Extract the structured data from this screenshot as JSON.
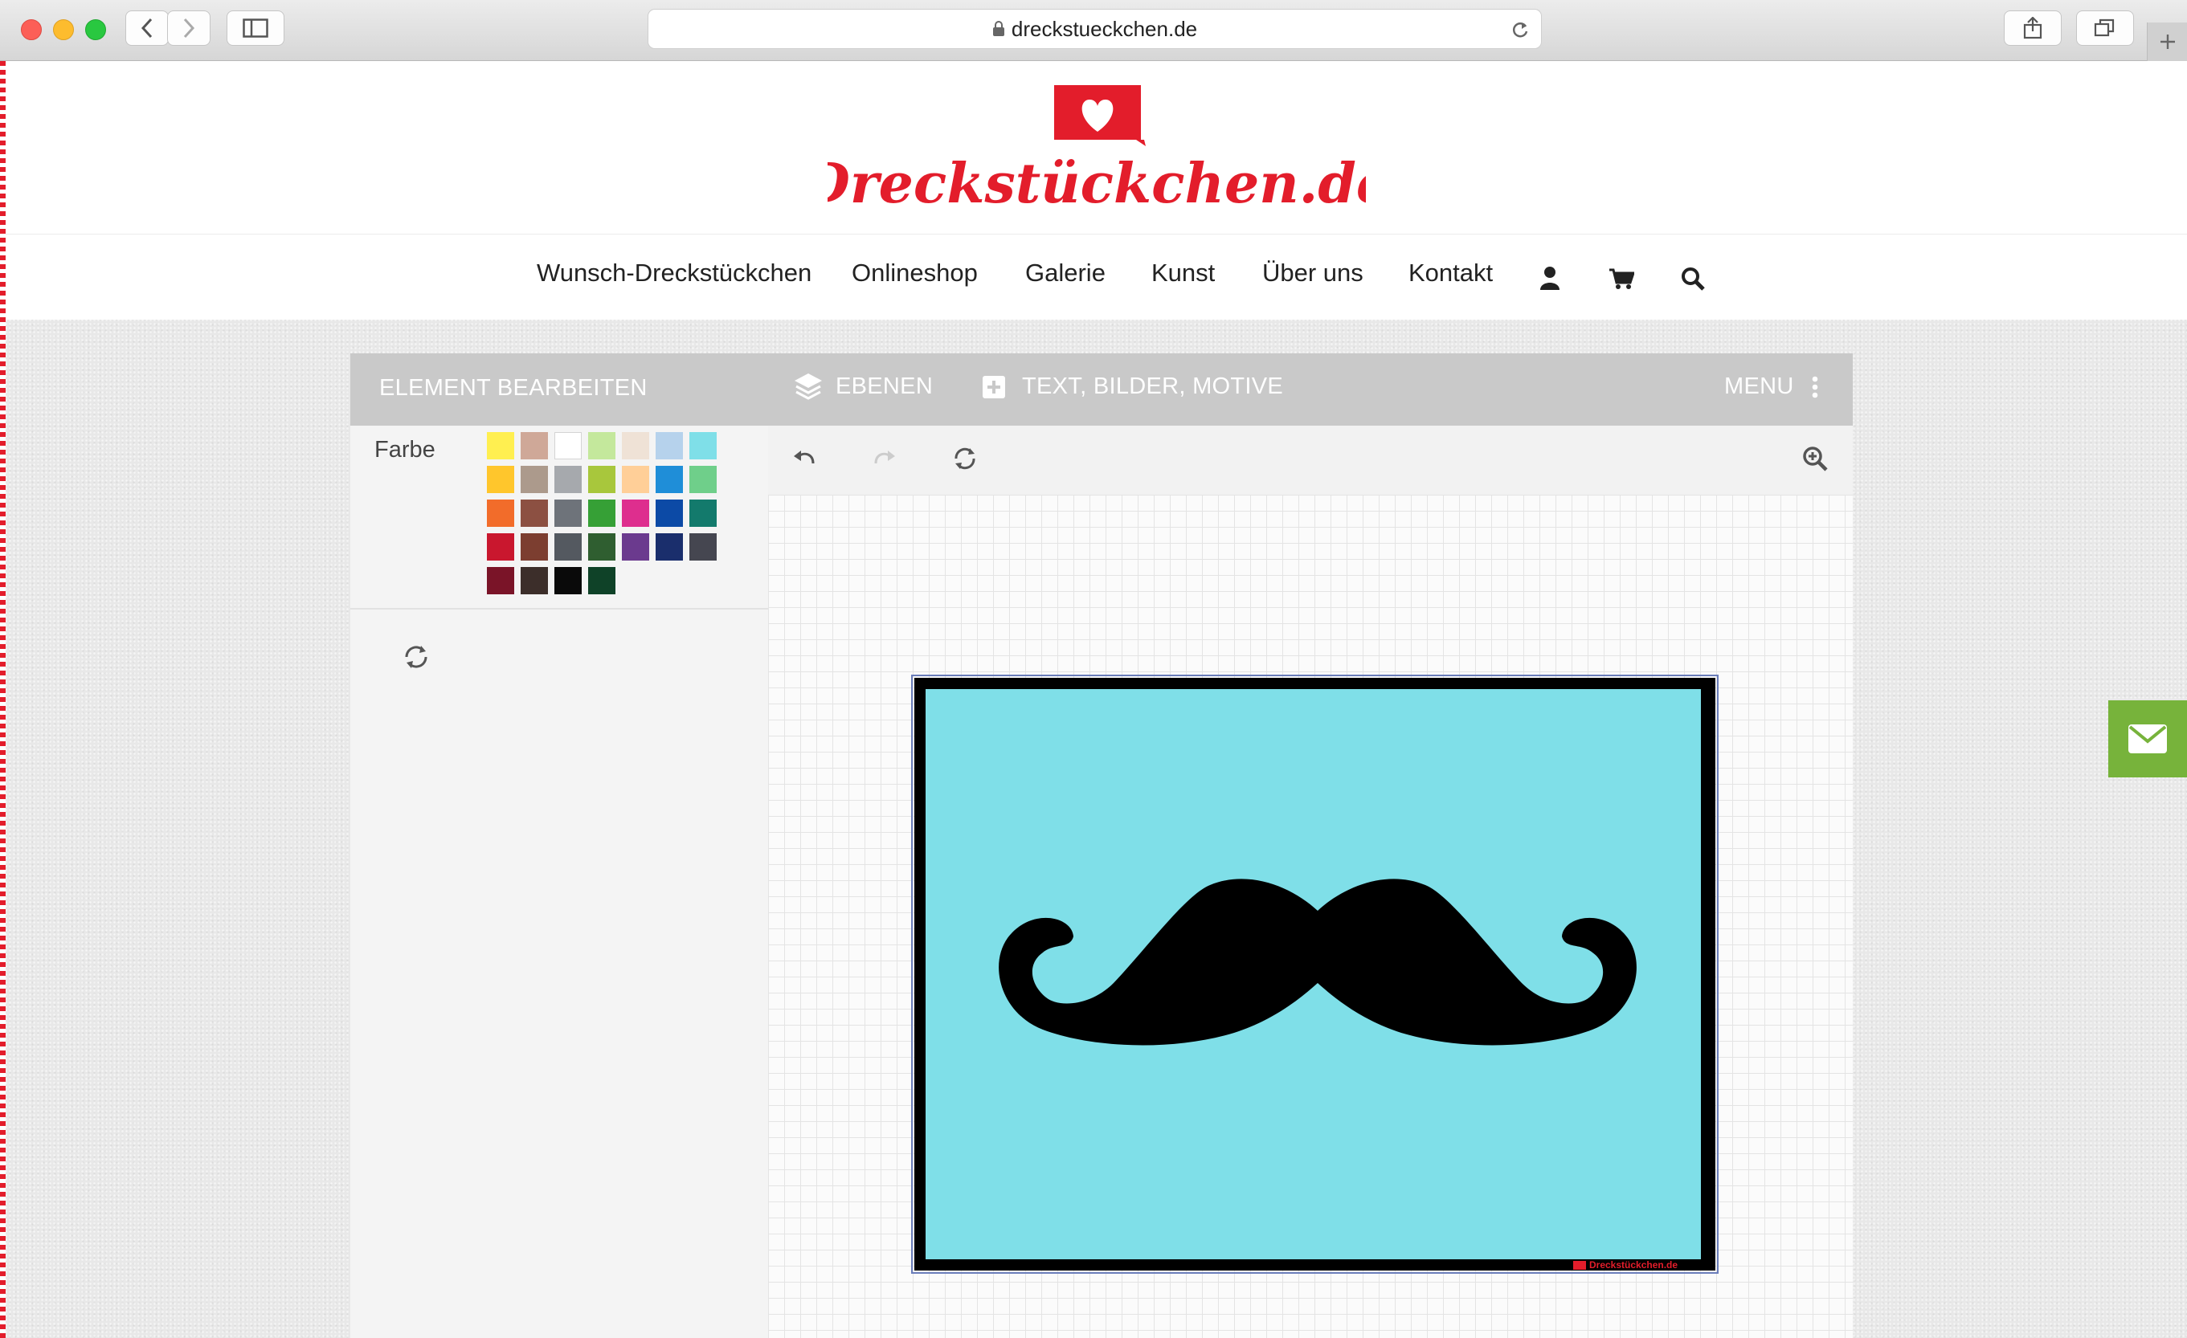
{
  "browser": {
    "url": "dreckstueckchen.de",
    "traffic_lights": [
      "#fc5f57",
      "#fdbc2e",
      "#29c840"
    ]
  },
  "site": {
    "logo_text": "Dreckstückchen.de",
    "brand_color": "#e31d2b",
    "nav": [
      {
        "label": "Wunsch-Dreckstückchen"
      },
      {
        "label": "Onlineshop"
      },
      {
        "label": "Galerie"
      },
      {
        "label": "Kunst"
      },
      {
        "label": "Über uns"
      },
      {
        "label": "Kontakt"
      }
    ],
    "nav_icons": [
      "user-icon",
      "cart-icon",
      "search-icon"
    ]
  },
  "editor": {
    "toolbar": {
      "edit_element": "ELEMENT BEARBEITEN",
      "layers": "EBENEN",
      "add_content": "TEXT, BILDER, MOTIVE",
      "menu": "MENU"
    },
    "color_label": "Farbe",
    "palette": [
      "#ffef50",
      "#cfa898",
      "#ffffff",
      "#c4e89c",
      "#efe2d6",
      "#b6d2ec",
      "#7fdfe8",
      "#ffc62c",
      "#ac9a8c",
      "#a6a9ad",
      "#a8c73c",
      "#ffcf98",
      "#1f8ed8",
      "#6fcf8a",
      "#f26c2a",
      "#8c5042",
      "#6e737a",
      "#36a036",
      "#de2e8e",
      "#0c4aa6",
      "#137a6c",
      "#c9172e",
      "#7c3e30",
      "#545960",
      "#2f5e30",
      "#6b3a8e",
      "#1a2e6c",
      "#454650",
      "#7a1428",
      "#3c2e2a",
      "#0a0a0a",
      "#0f4228"
    ],
    "canvas_colors": {
      "background": "#7fdfe8",
      "border": "#000000"
    },
    "watermark": "Dreckstückchen.de"
  }
}
